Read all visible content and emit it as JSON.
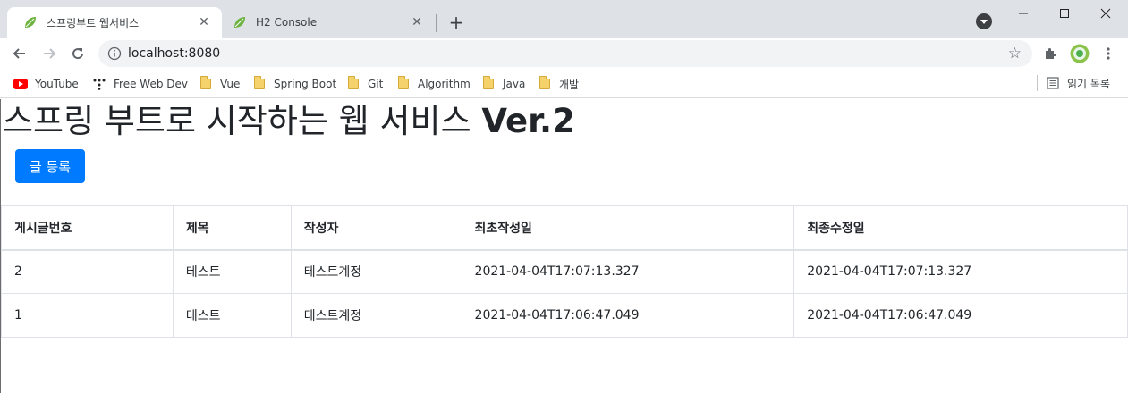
{
  "browser": {
    "tabs": [
      {
        "title": "스프링부트 웹서비스",
        "active": true
      },
      {
        "title": "H2 Console",
        "active": false
      }
    ],
    "new_tab_symbol": "+",
    "address": "localhost:8080",
    "window_controls": [
      "minimize-icon",
      "maximize-icon",
      "close-icon"
    ]
  },
  "bookmarks": [
    {
      "label": "YouTube",
      "icon": "youtube-icon"
    },
    {
      "label": "Free Web Dev",
      "icon": "devtools-icon"
    },
    {
      "label": "Vue",
      "icon": "folder-icon"
    },
    {
      "label": "Spring Boot",
      "icon": "folder-icon"
    },
    {
      "label": "Git",
      "icon": "folder-icon"
    },
    {
      "label": "Algorithm",
      "icon": "folder-icon"
    },
    {
      "label": "Java",
      "icon": "folder-icon"
    },
    {
      "label": "개발",
      "icon": "folder-icon"
    }
  ],
  "reading_list": "읽기 목록",
  "page": {
    "title_main": "스프링 부트로 시작하는 웹 서비스 ",
    "title_version": "Ver.2",
    "register_button": "글 등록",
    "table": {
      "headers": [
        "게시글번호",
        "제목",
        "작성자",
        "최초작성일",
        "최종수정일"
      ],
      "rows": [
        [
          "2",
          "테스트",
          "테스트계정",
          "2021-04-04T17:07:13.327",
          "2021-04-04T17:07:13.327"
        ],
        [
          "1",
          "테스트",
          "테스트계정",
          "2021-04-04T17:06:47.049",
          "2021-04-04T17:06:47.049"
        ]
      ]
    }
  },
  "colors": {
    "primary_button": "#007bff",
    "tabstrip": "#dee1e6",
    "spring_leaf": "#6db33f"
  }
}
